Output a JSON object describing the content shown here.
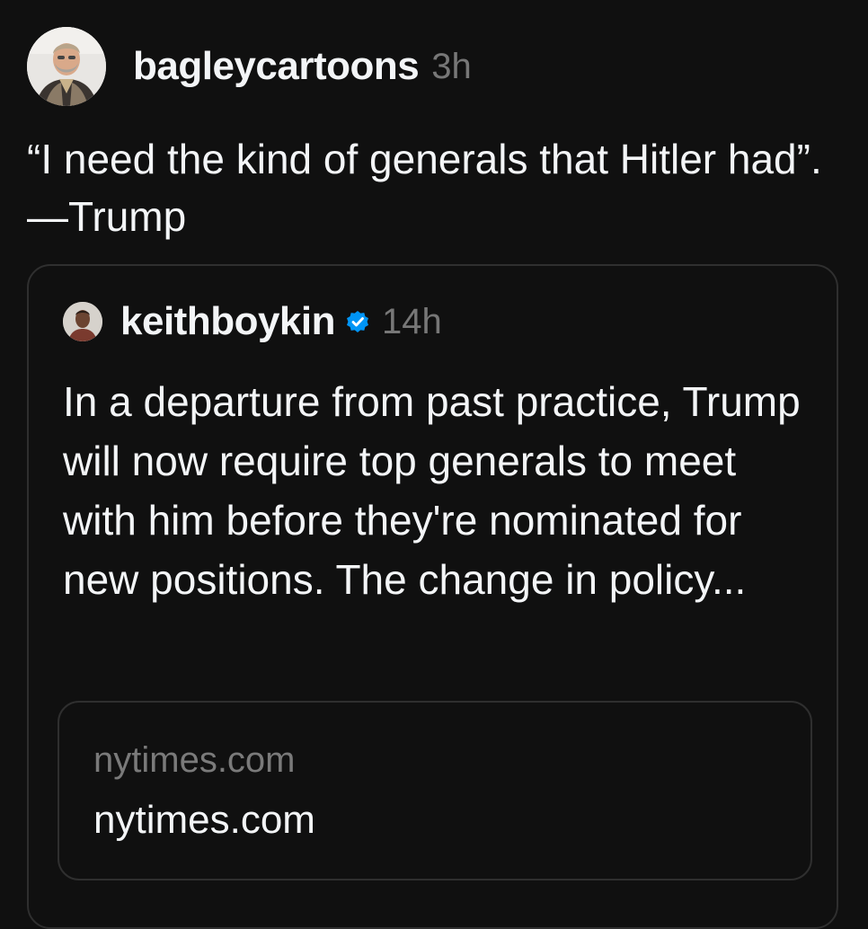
{
  "post": {
    "author": {
      "username": "bagleycartoons",
      "time_ago": "3h"
    },
    "text": "“I need the kind of generals that Hitler had”. —Trump",
    "quoted_post": {
      "author": {
        "username": "keithboykin",
        "verified": true,
        "time_ago": "14h"
      },
      "text": "In a departure from past practice, Trump will now require top generals to meet with him before they're nominated for new positions. The change in policy...",
      "link_preview": {
        "domain": "nytimes.com",
        "title": "nytimes.com"
      }
    }
  },
  "colors": {
    "background": "#101010",
    "primary_text": "#f3f5f7",
    "secondary_text": "#777777",
    "border": "#2f2f2f",
    "verified_badge": "#0095f6"
  }
}
